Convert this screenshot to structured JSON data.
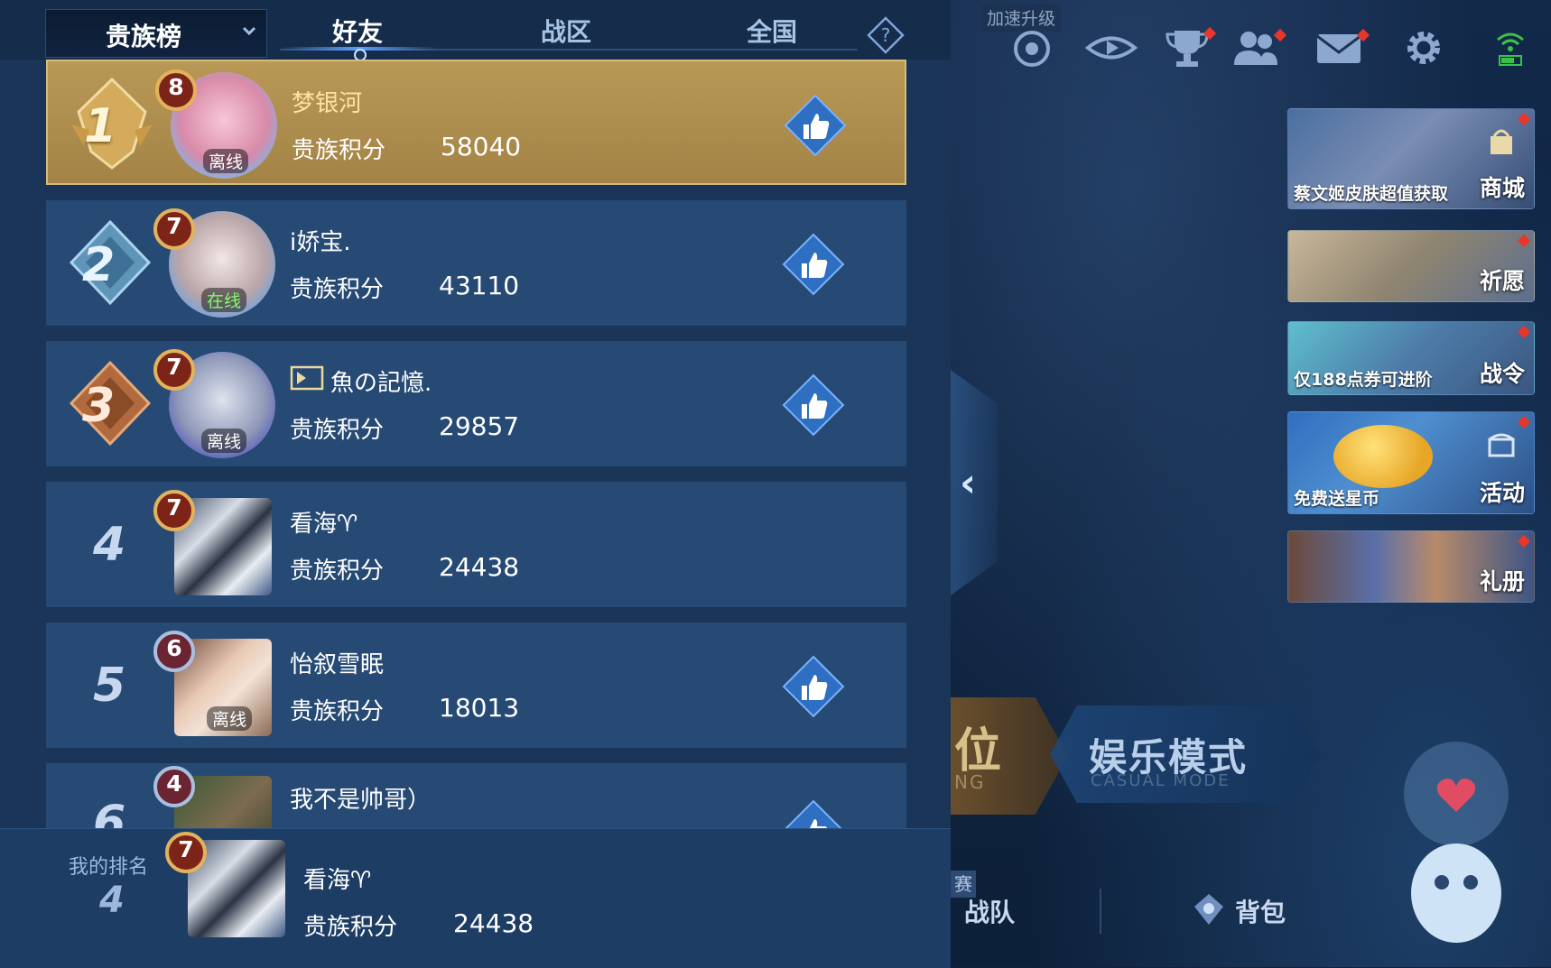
{
  "header": {
    "board_selector": "贵族榜",
    "tabs": [
      "好友",
      "战区",
      "全国"
    ],
    "active_tab": "好友"
  },
  "rows": [
    {
      "rank": "1",
      "level": "8",
      "name": "梦银河",
      "status": "离线",
      "score_label": "贵族积分",
      "score": "58040",
      "like": true
    },
    {
      "rank": "2",
      "level": "7",
      "name": "i娇宝.",
      "status": "在线",
      "score_label": "贵族积分",
      "score": "43110",
      "like": true
    },
    {
      "rank": "3",
      "level": "7",
      "name": "魚の記憶.",
      "status": "离线",
      "score_label": "贵族积分",
      "score": "29857",
      "like": true
    },
    {
      "rank": "4",
      "level": "7",
      "name": "看海♈",
      "status": "",
      "score_label": "贵族积分",
      "score": "24438",
      "like": false
    },
    {
      "rank": "5",
      "level": "6",
      "name": "怡叙雪眠",
      "status": "离线",
      "score_label": "贵族积分",
      "score": "18013",
      "like": true
    },
    {
      "rank": "6",
      "level": "4",
      "name": "我不是帅哥）",
      "status": "",
      "score_label": "",
      "score": "",
      "like": true
    }
  ],
  "my_rank": {
    "label": "我的排名",
    "rank": "4",
    "level": "7",
    "name": "看海♈",
    "score_label": "贵族积分",
    "score": "24438"
  },
  "lobby": {
    "speedup_label": "加速升级",
    "promos": [
      {
        "caption": "蔡文姬皮肤超值获取",
        "side": "商城"
      },
      {
        "caption": "",
        "side": "祈愿"
      },
      {
        "caption": "仅188点券可进阶",
        "side": "战令"
      },
      {
        "caption": "免费送星币",
        "side": "活动"
      },
      {
        "caption": "",
        "side": "礼册"
      }
    ],
    "rank_mode_label": "位",
    "rank_mode_sub": "NG",
    "casual_mode_label": "娱乐模式",
    "casual_mode_sub": "CASUAL MODE",
    "match_tag": "赛",
    "team_label": "战队",
    "bag_label": "背包"
  },
  "colors": {
    "panel_bg": "#1a3558",
    "row_bg": "#264a74",
    "gold_row": "#b99856",
    "accent_blue": "#5aa2ff",
    "online_green": "#7dff6f",
    "notify_red": "#e8362b"
  }
}
